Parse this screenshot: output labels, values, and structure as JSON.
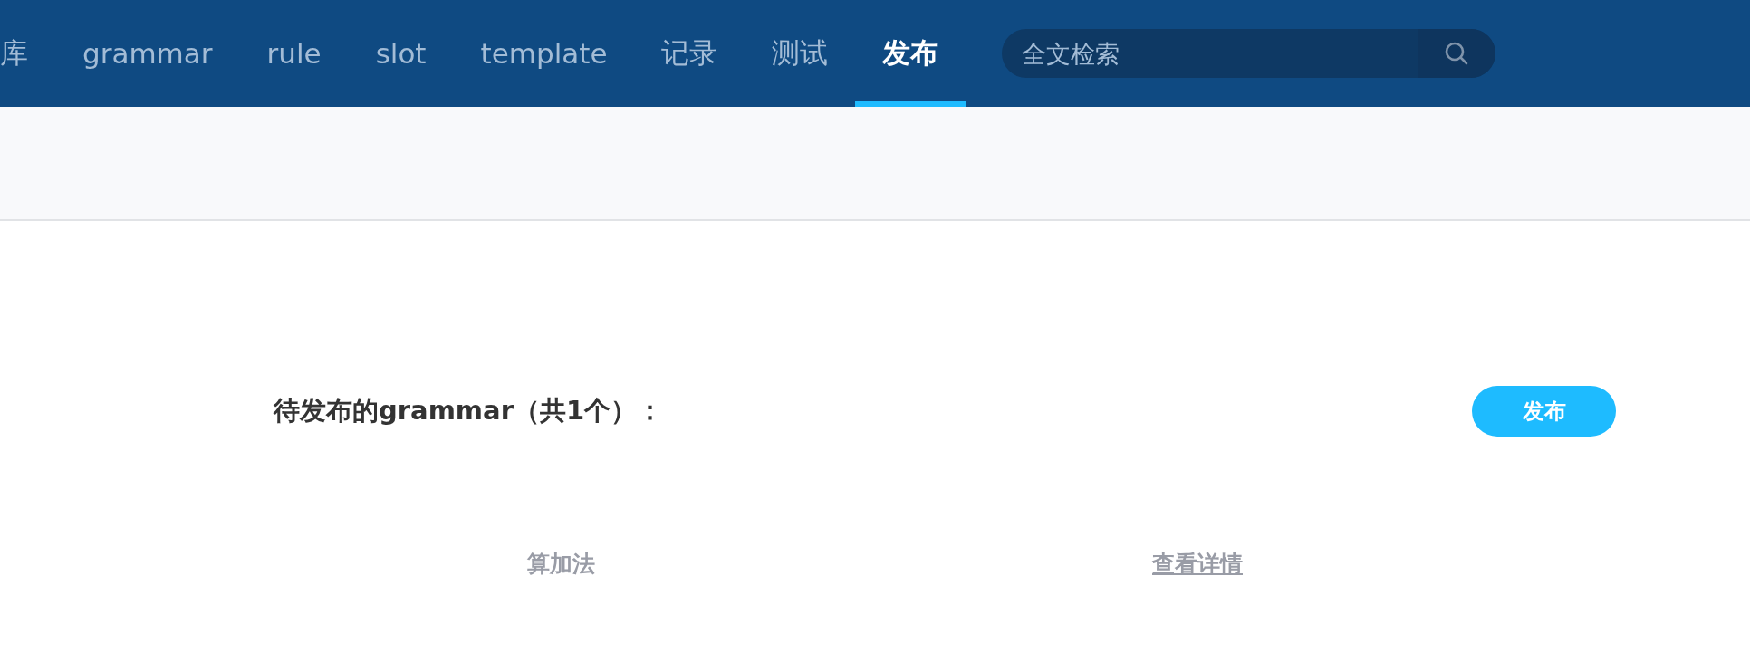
{
  "nav": {
    "items": [
      {
        "label": "库",
        "selected": false
      },
      {
        "label": "grammar",
        "selected": false
      },
      {
        "label": "rule",
        "selected": false
      },
      {
        "label": "slot",
        "selected": false
      },
      {
        "label": "template",
        "selected": false
      },
      {
        "label": "记录",
        "selected": false
      },
      {
        "label": "测试",
        "selected": false
      },
      {
        "label": "发布",
        "selected": true
      }
    ],
    "search": {
      "placeholder": "全文检索"
    }
  },
  "publish": {
    "heading": "待发布的grammar（共1个）：",
    "button": "发布",
    "rows": [
      {
        "name": "算加法",
        "link": "查看详情"
      }
    ]
  }
}
